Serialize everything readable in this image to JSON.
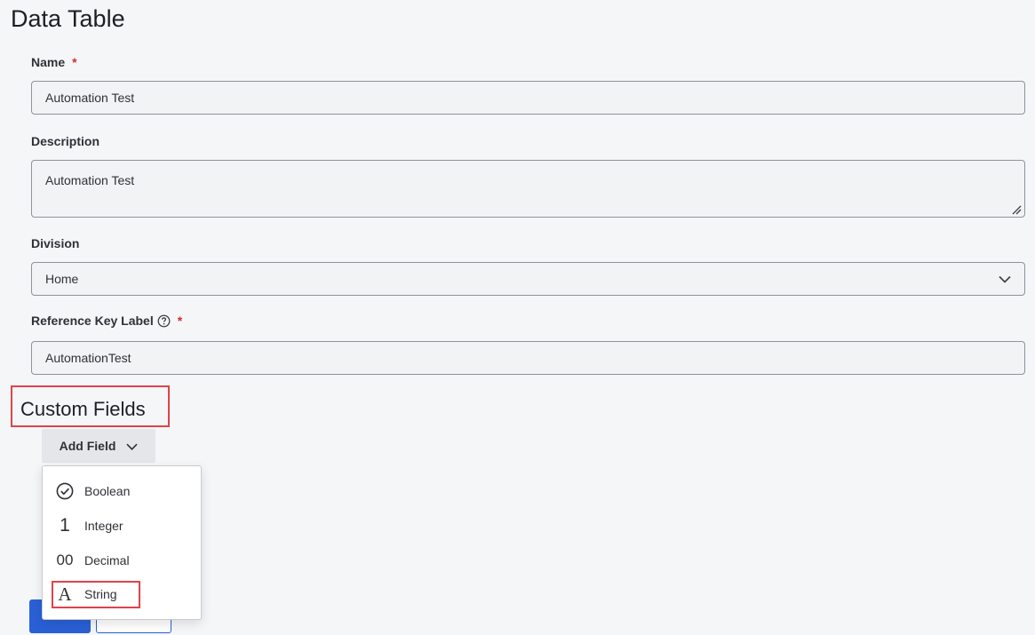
{
  "page": {
    "title": "Data Table"
  },
  "form": {
    "name": {
      "label": "Name",
      "required_mark": "*",
      "value": "Automation Test"
    },
    "description": {
      "label": "Description",
      "value": "Automation Test"
    },
    "division": {
      "label": "Division",
      "value": "Home"
    },
    "reference_key": {
      "label": "Reference Key Label",
      "required_mark": "*",
      "value": "AutomationTest"
    }
  },
  "custom_fields": {
    "title": "Custom Fields",
    "add_field_label": "Add Field",
    "menu": [
      {
        "label": "Boolean",
        "icon": "check-circle-icon"
      },
      {
        "label": "Integer",
        "icon": "number-one-icon",
        "glyph": "1"
      },
      {
        "label": "Decimal",
        "icon": "decimal-icon",
        "glyph": "00"
      },
      {
        "label": "String",
        "icon": "letter-a-icon",
        "glyph": "A"
      }
    ]
  },
  "colors": {
    "accent": "#2a60d6",
    "highlight": "#e0434a",
    "required": "#d22c2c"
  }
}
